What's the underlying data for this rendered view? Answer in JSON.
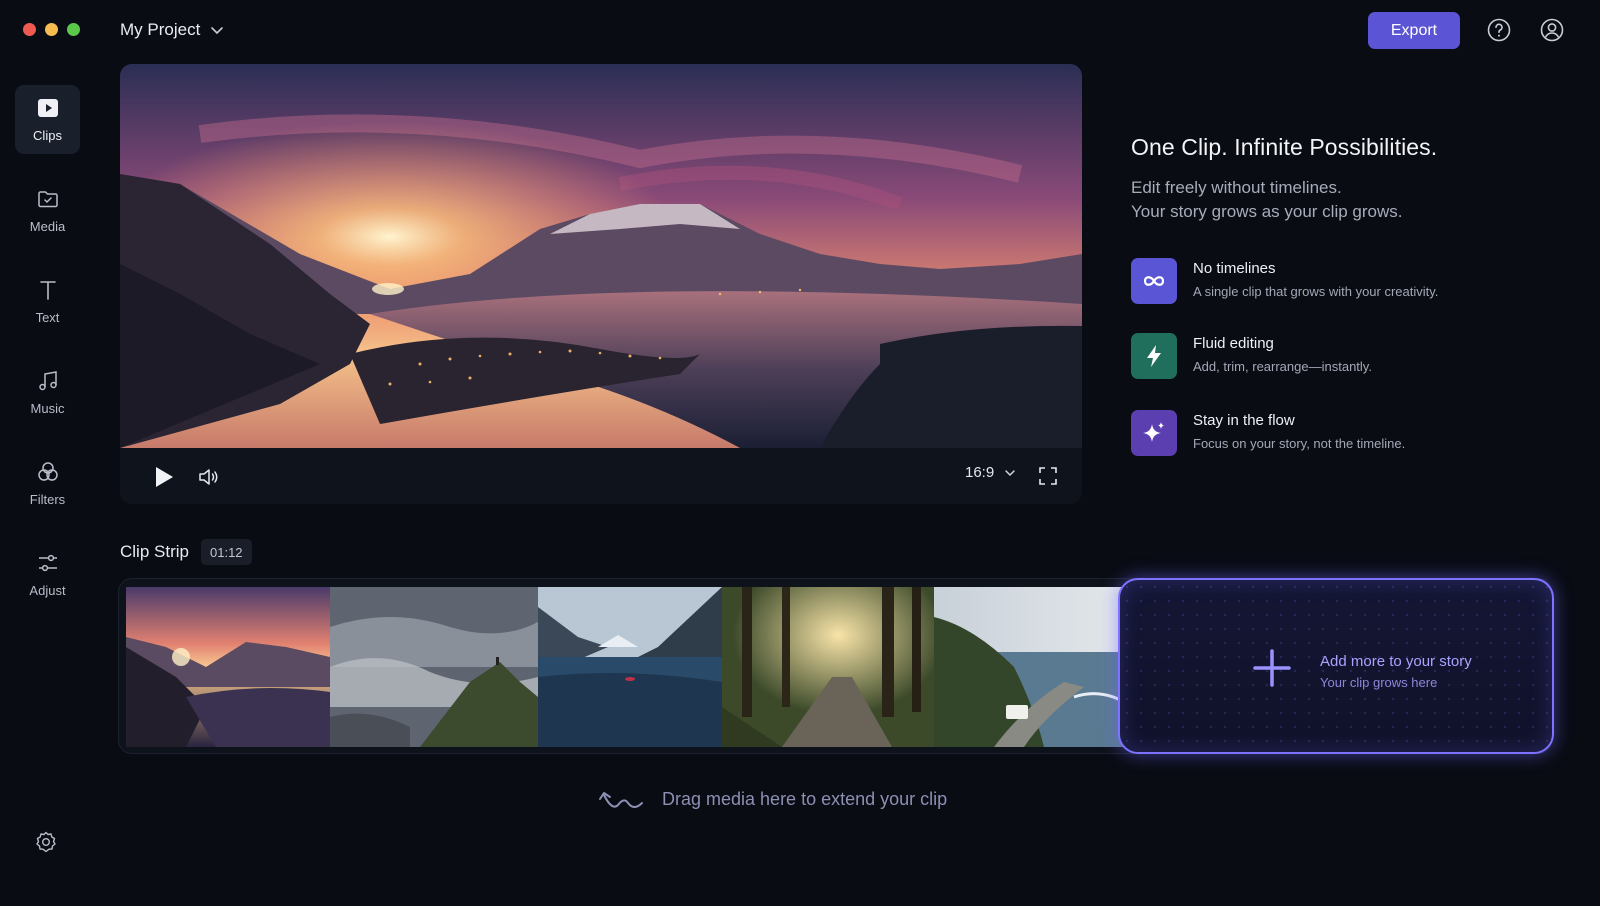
{
  "window": {
    "traffic_colors": [
      "#ee5a52",
      "#f5bd4f",
      "#5bc74b"
    ]
  },
  "header": {
    "project_name": "My Project",
    "export_label": "Export",
    "icons": [
      "chevron-down-icon",
      "help-icon",
      "account-icon"
    ]
  },
  "sidebar": {
    "items": [
      {
        "label": "Clips",
        "icon": "play-square-icon",
        "active": true
      },
      {
        "label": "Media",
        "icon": "folder-icon",
        "active": false
      },
      {
        "label": "Text",
        "icon": "text-icon",
        "active": false
      },
      {
        "label": "Music",
        "icon": "music-note-icon",
        "active": false
      },
      {
        "label": "Filters",
        "icon": "filters-icon",
        "active": false
      },
      {
        "label": "Adjust",
        "icon": "sliders-icon",
        "active": false
      }
    ],
    "settings_icon": "gear-icon"
  },
  "player": {
    "aspect_ratio": "16:9",
    "icons": [
      "play-icon",
      "volume-icon",
      "chevron-down-icon",
      "fullscreen-icon"
    ]
  },
  "promo": {
    "title": "One Clip. Infinite Possibilities.",
    "subtitle_line1": "Edit freely without timelines.",
    "subtitle_line2": "Your story grows as your clip grows.",
    "features": [
      {
        "title": "No timelines",
        "desc": "A single clip that grows with your creativity.",
        "icon": "infinity-icon",
        "color": "#5a55d4"
      },
      {
        "title": "Fluid editing",
        "desc": "Add, trim, rearrange—instantly.",
        "icon": "lightning-icon",
        "color": "#1f6f5c"
      },
      {
        "title": "Stay in the flow",
        "desc": "Focus on your story, not the timeline.",
        "icon": "sparkle-icon",
        "color": "#5b3fb0"
      }
    ]
  },
  "clip_strip": {
    "label": "Clip Strip",
    "duration": "01:12",
    "thumbnails": [
      "sunset-lake",
      "misty-cliff",
      "fjord-kayak",
      "forest-road",
      "coastal-road"
    ],
    "add_title": "Add more to your story",
    "add_subtitle": "Your clip grows here",
    "drag_hint": "Drag media here to extend your clip",
    "accent": "#7d73ff"
  }
}
